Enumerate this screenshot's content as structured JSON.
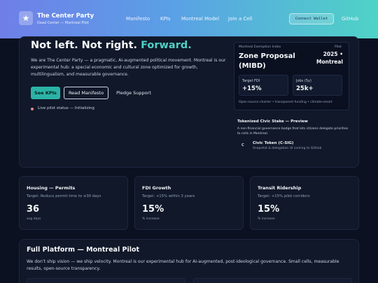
{
  "header": {
    "brand_title": "The Center Party",
    "brand_sub": "Dead Center — Montreal Pilot",
    "nav": [
      "Manifesto",
      "KPIs",
      "Montreal Model",
      "Join a Cell"
    ],
    "wallet_label": "Connect Wallet",
    "github_label": "GitHub",
    "logo_icon": "star-icon",
    "gradient": [
      "#6f7fe8",
      "#5aa0e6",
      "#4fd3c6"
    ]
  },
  "hero": {
    "headline_main": "Not left. Not right.",
    "headline_accent": "Forward.",
    "lede": "We are The Center Party — a pragmatic, AI-augmented political movement. Montreal is our experimental hub: a special economic and cultural zone optimized for growth, multilingualism, and measurable governance.",
    "primary_button": "See KPIs",
    "secondary_button": "Read Manifesto",
    "tertiary_button": "Pledge Support",
    "status": "Live pilot status — Initializing"
  },
  "proposal": {
    "kicker": "Montreal Exemption Index",
    "pilot_label": "Pilot",
    "title": "Zone Proposal (MIBD)",
    "year_city": "2025 • Montreal",
    "stats": [
      {
        "label": "Target FDI",
        "value": "+15%"
      },
      {
        "label": "Jobs (5y)",
        "value": "25k+"
      }
    ],
    "footer": "Open-source charter • transparent funding • climate-smart"
  },
  "civic": {
    "title": "Tokenized Civic Stake — Preview",
    "desc": "A non-financial governance badge that lets citizens delegate priorities to cells in Montreal.",
    "mark": "C",
    "token": "Civic Token (C-SIG)",
    "token_sub": "Snapshot & delegation UI coming to GitHub"
  },
  "kpis": [
    {
      "title": "Housing — Permits",
      "target": "Target: Reduce permit time to ≤30 days",
      "value": "36",
      "unit": "avg days"
    },
    {
      "title": "FDI Growth",
      "target": "Target: +15% within 3 years",
      "value": "15%",
      "unit": "% increase"
    },
    {
      "title": "Transit Ridership",
      "target": "Target: +15% pilot corridors",
      "value": "15%",
      "unit": "% increase"
    }
  ],
  "platform": {
    "title": "Full Platform — Montreal Pilot",
    "desc": "We don’t ship vision — we ship velocity. Montreal is our experimental hub for AI-augmented, post-ideological governance. Small cells, measurable results, open-source transparency."
  },
  "colors": {
    "accent": "#4fd1c5",
    "primary_button": "#2bb3a6",
    "status_dot": "#e28a8a",
    "background": "#0b1120"
  }
}
